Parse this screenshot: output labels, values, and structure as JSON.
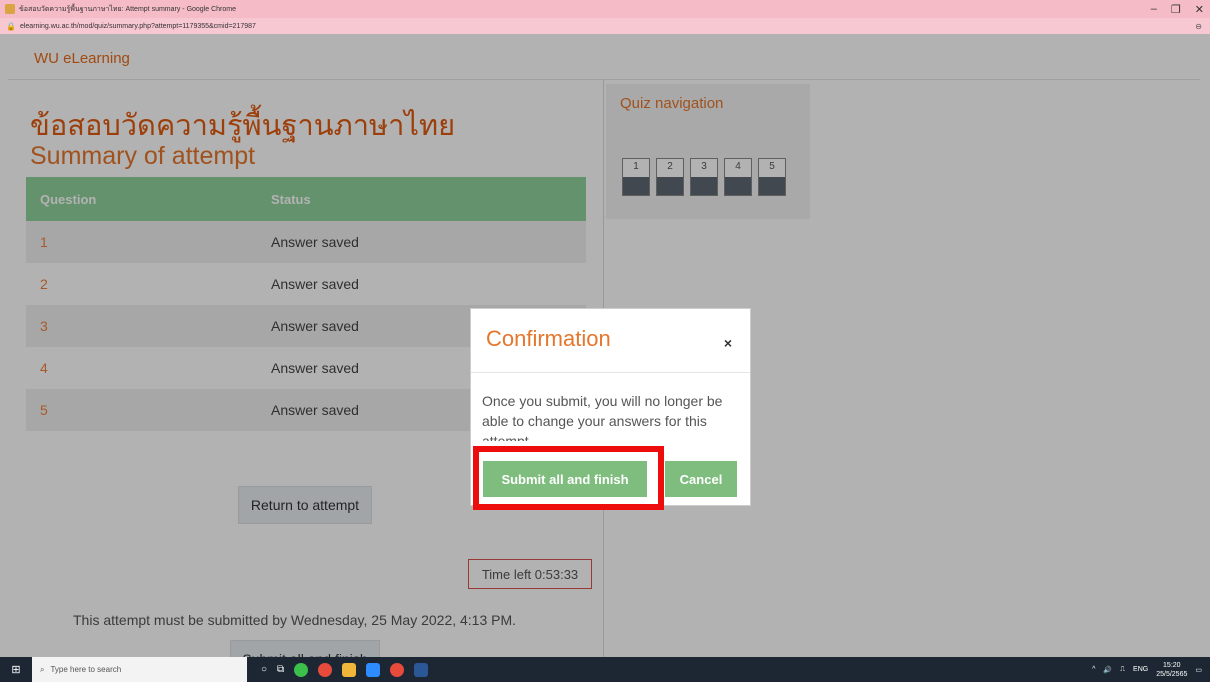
{
  "browser": {
    "tab_title": "ข้อสอบวัดความรู้พื้นฐานภาษาไทย: Attempt summary - Google Chrome",
    "url": "elearning.wu.ac.th/mod/quiz/summary.php?attempt=1179355&cmid=217987",
    "minimize": "–",
    "maximize": "❐",
    "close": "✕"
  },
  "site": {
    "brand": "WU eLearning"
  },
  "page": {
    "title": "ข้อสอบวัดความรู้พื้นฐานภาษาไทย",
    "subtitle": "Summary of attempt",
    "table": {
      "headers": [
        "Question",
        "Status"
      ],
      "rows": [
        {
          "q": "1",
          "status": "Answer saved"
        },
        {
          "q": "2",
          "status": "Answer saved"
        },
        {
          "q": "3",
          "status": "Answer saved"
        },
        {
          "q": "4",
          "status": "Answer saved"
        },
        {
          "q": "5",
          "status": "Answer saved"
        }
      ]
    },
    "return_button": "Return to attempt",
    "timer": "Time left 0:53:33",
    "deadline": "This attempt must be submitted by Wednesday, 25 May 2022, 4:13 PM.",
    "submit_button": "Submit all and finish"
  },
  "quiz_nav": {
    "title": "Quiz navigation",
    "buttons": [
      "1",
      "2",
      "3",
      "4",
      "5"
    ]
  },
  "modal": {
    "title": "Confirmation",
    "close": "×",
    "body": "Once you submit, you will no longer be able to change your answers for this attempt.",
    "submit": "Submit all and finish",
    "cancel": "Cancel"
  },
  "taskbar": {
    "search_placeholder": "Type here to search",
    "language": "ENG",
    "time": "15:20",
    "date": "25/5/2565"
  },
  "colors": {
    "accent": "#e6762b",
    "table_header": "#8fd29c",
    "button_green": "#7ebd7d",
    "highlight": "#ee0d0d"
  }
}
